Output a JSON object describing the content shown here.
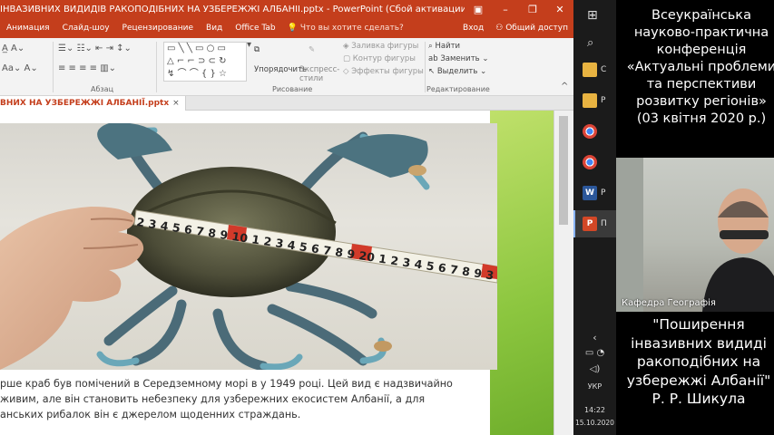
{
  "window": {
    "title": "ІНВАЗИВНИХ ВИДИДІВ РАКОПОДІБНИХ НА УЗБЕРЕЖЖІ АЛБАНІЇ.pptx - PowerPoint (Сбой активации продукта)",
    "colors": {
      "accent": "#c43e1c",
      "ribbon": "#f3f3f3"
    }
  },
  "menu": {
    "items": [
      "Анимация",
      "Слайд-шоу",
      "Рецензирование",
      "Вид",
      "Office Tab"
    ],
    "tell_me": "Что вы хотите сделать?",
    "signin": "Вход",
    "share": "Общий доступ"
  },
  "ribbon": {
    "paragraph_label": "Абзац",
    "drawing_label": "Рисование",
    "editing_label": "Редактирование",
    "arrange": "Упорядочить",
    "express_styles": "Экспресс-стили",
    "fill": "Заливка фигуры",
    "outline": "Контур фигуры",
    "effects": "Эффекты фигуры",
    "find": "Найти",
    "replace": "Заменить",
    "select": "Выделить"
  },
  "doc_tab": {
    "label": "ВНИХ НА УЗБЕРЕЖЖІ АЛБАНІЇ.pptx",
    "close": "×"
  },
  "slide": {
    "tape_digits_1": "2 3 4 5 6 7 8 9 10 1 2 3 4 5 6 7 8 9 20 1 2 3 4 5 6 7 8 9 3",
    "text_lines": [
      "рше краб був помічений в Середземному морі в у 1949 році. Цей вид є надзвичайно",
      "живим, але він становить небезпеку для узбережних екосистем Албанії, а для",
      "анських рибалок він є джерелом щоденних страждань."
    ]
  },
  "taskbar": {
    "items": [
      {
        "label": "С",
        "icon": "folder-icon",
        "color": "#e8b341"
      },
      {
        "label": "Р",
        "icon": "folder-icon",
        "color": "#e8b341"
      },
      {
        "label": "",
        "icon": "chrome-icon",
        "color": "#db4437"
      },
      {
        "label": "",
        "icon": "chrome-icon",
        "color": "#db4437"
      },
      {
        "label": "Р",
        "icon": "word-icon",
        "color": "#2b579a"
      },
      {
        "label": "П",
        "icon": "powerpoint-icon",
        "color": "#d24726"
      }
    ],
    "lang": "УКР",
    "time": "14:22",
    "date": "15.10.2020"
  },
  "right_panel": {
    "conference_lines": [
      "Всеукраїнська",
      "науково-практична",
      "конференція",
      "«Актуальні проблеми",
      "та перспективи",
      "розвитку регіонів»",
      "(03 квітня 2020 р.)"
    ],
    "camera_label": "Кафедра Географія",
    "talk_lines": [
      "\"Поширення",
      "інвазивних видиді",
      "ракоподібних на",
      "узбережжі Албанії\"",
      "Р. Р. Шикула"
    ]
  }
}
